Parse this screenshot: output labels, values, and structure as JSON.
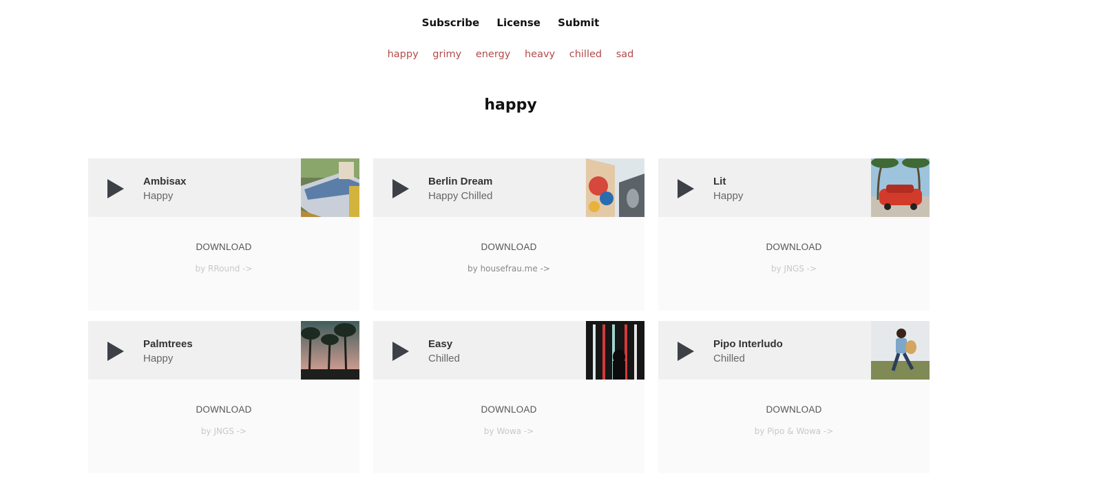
{
  "nav": {
    "items": [
      "Subscribe",
      "License",
      "Submit"
    ]
  },
  "moods": [
    "happy",
    "grimy",
    "energy",
    "heavy",
    "chilled",
    "sad"
  ],
  "page": {
    "title": "happy"
  },
  "download_label": "DOWNLOAD",
  "tracks": [
    {
      "title": "Ambisax",
      "tags": "Happy",
      "artist": "by RRound ->",
      "thumb": "train-window-photo"
    },
    {
      "title": "Berlin Dream",
      "tags": "Happy Chilled",
      "artist": "by housefrau.me ->",
      "thumb": "graffiti-wall-photo"
    },
    {
      "title": "Lit",
      "tags": "Happy",
      "artist": "by JNGS ->",
      "thumb": "red-classic-car-photo"
    },
    {
      "title": "Palmtrees",
      "tags": "Happy",
      "artist": "by JNGS ->",
      "thumb": "palm-trees-sunset-photo"
    },
    {
      "title": "Easy",
      "tags": "Chilled",
      "artist": "by Wowa ->",
      "thumb": "neon-lights-silhouette-photo"
    },
    {
      "title": "Pipo Interludo",
      "tags": "Chilled",
      "artist": "by Pipo & Wowa ->",
      "thumb": "running-child-guitar-photo"
    }
  ],
  "colors": {
    "mood_link": "#b34a4a",
    "card_head": "#f0f0f0",
    "card_body": "#fafafa",
    "play_icon": "#3d4047"
  }
}
